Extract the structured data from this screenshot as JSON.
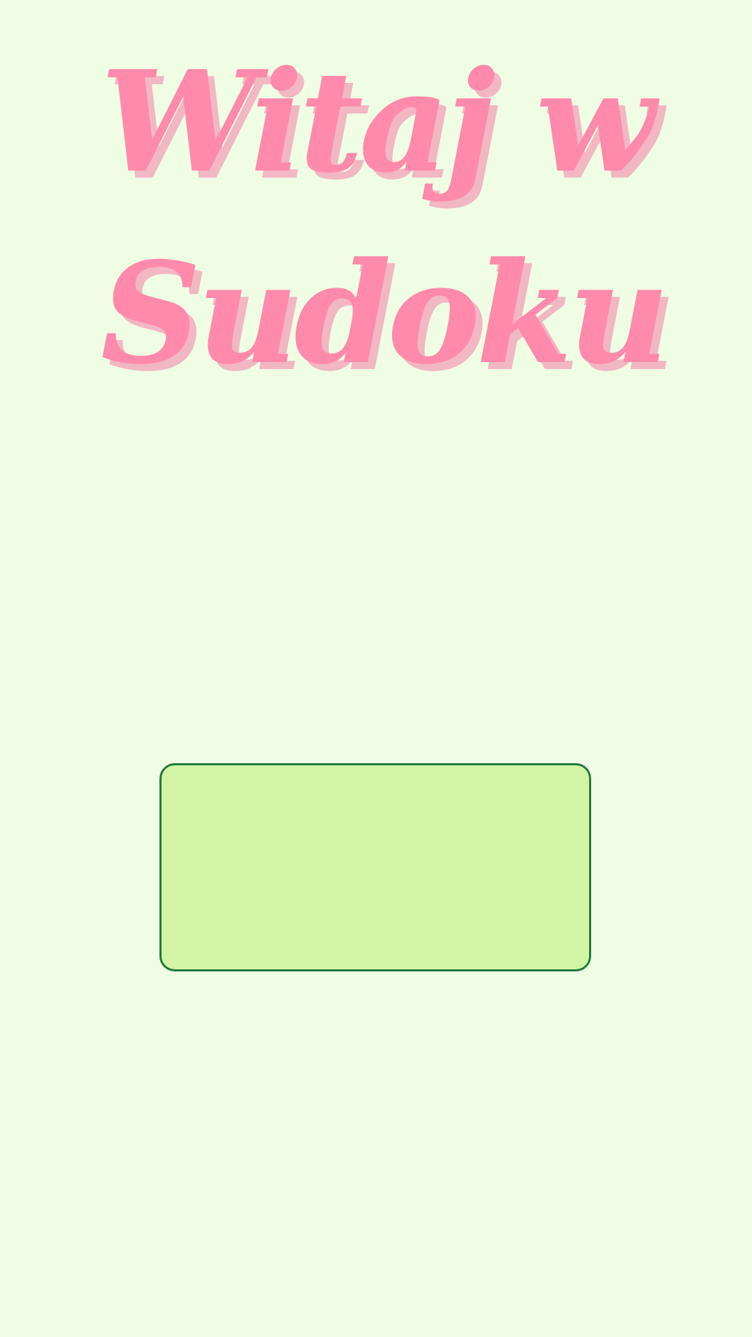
{
  "screen": {
    "background_color": "#effde5"
  },
  "title": {
    "line1": "Witaj w",
    "line2": "Sudoku",
    "fill_color": "#ff8aab",
    "shadow_color": "#f2a0b8"
  },
  "start_button": {
    "label": "",
    "fill_color": "#d1f5a5",
    "border_color": "#1e7a3c"
  }
}
